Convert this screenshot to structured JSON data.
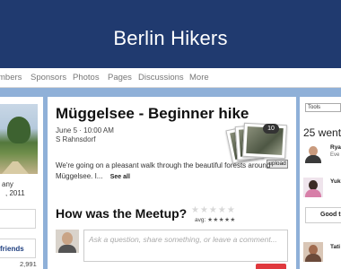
{
  "banner": {
    "title": "Berlin Hikers"
  },
  "nav": {
    "items": [
      "mbers",
      "Sponsors",
      "Photos",
      "Pages",
      "Discussions",
      "More"
    ]
  },
  "sidebar": {
    "line1": "any",
    "line2": ", 2011",
    "friends_label": "friends",
    "count": "2,991"
  },
  "event": {
    "title": "Müggelsee - Beginner hike",
    "date": "June 5 · 10:00 AM",
    "location": "S Rahnsdorf",
    "photo_count": "10",
    "upload_label": "upload",
    "description": "We're going on a pleasant walk through the beautiful forests around Müggelsee. I...",
    "see_all": "See all"
  },
  "rating": {
    "title": "How was the Meetup?",
    "stars": "★★★★★",
    "avg_label": "avg:",
    "avg_stars": "★★★★★"
  },
  "comment": {
    "placeholder": "Ask a question, share something, or leave a comment..."
  },
  "right": {
    "tools_label": "Tools",
    "went": "25 went",
    "attendees": [
      {
        "name": "Rya",
        "sub": "Eve"
      },
      {
        "name": "Yuk",
        "sub": ""
      },
      {
        "name": "Tati",
        "sub": ""
      }
    ],
    "good_label": "Good t"
  },
  "colors": {
    "banner": "#203a6f",
    "background": "#8fb0d8",
    "accent": "#e0393e"
  }
}
